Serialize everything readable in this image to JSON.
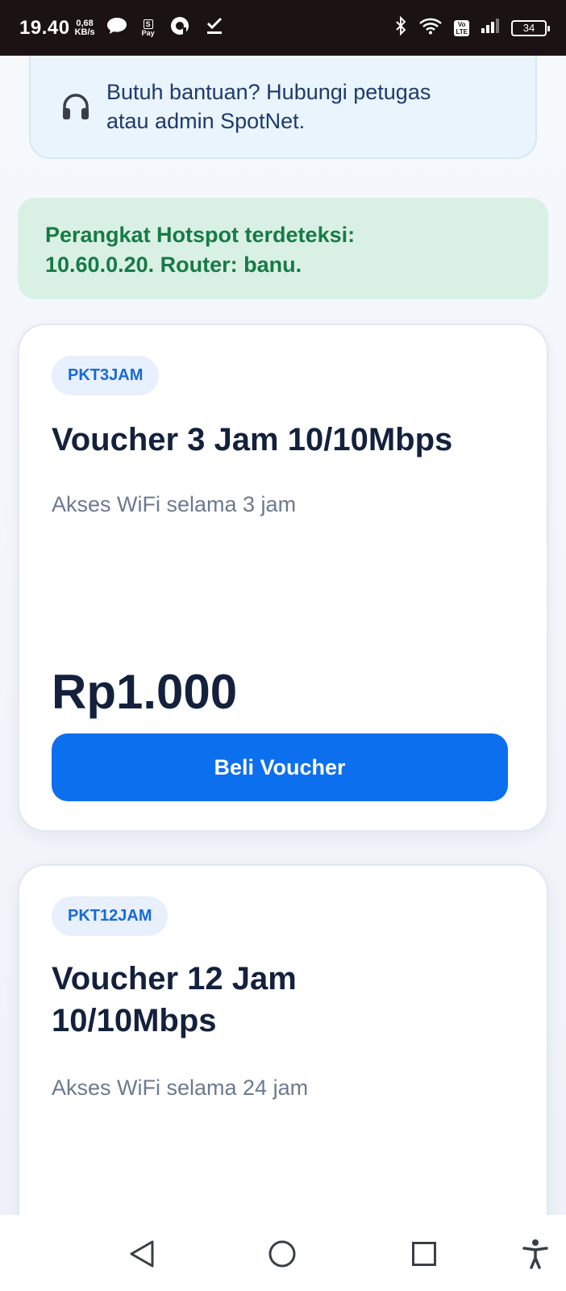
{
  "status_bar": {
    "time": "19.40",
    "speed_value": "0,68",
    "speed_unit": "KB/s",
    "volte_top": "Vo",
    "volte_bottom": "LTE",
    "battery": "34",
    "icons": [
      "chat-bubble-icon",
      "spay-icon",
      "circle-app-icon",
      "download-check-icon",
      "bluetooth-icon",
      "wifi-icon",
      "volte-icon",
      "signal-icon",
      "battery-icon"
    ],
    "spay_top": "S",
    "spay_bottom": "Pay"
  },
  "help_box": {
    "icon": "headset-icon",
    "text_line1": "Butuh bantuan? Hubungi petugas",
    "text_line2": "atau admin SpotNet."
  },
  "detect_box": {
    "line1": "Perangkat Hotspot terdeteksi:",
    "line2": "10.60.0.20. Router: banu."
  },
  "vouchers": [
    {
      "code": "PKT3JAM",
      "title": "Voucher 3 Jam 10/10Mbps",
      "description": "Akses WiFi selama 3 jam",
      "price": "Rp1.000",
      "button_label": "Beli Voucher"
    },
    {
      "code": "PKT12JAM",
      "title_line1": "Voucher 12 Jam",
      "title_line2": "10/10Mbps",
      "description": "Akses WiFi selama 24 jam"
    }
  ],
  "nav_bar": {
    "icons": [
      "back-icon",
      "home-icon",
      "recents-icon",
      "accessibility-icon"
    ]
  },
  "colors": {
    "primary_button": "#0c6fed",
    "badge_text": "#1769d8",
    "detect_text": "#177a46",
    "detect_bg": "#d9f1e4",
    "help_bg": "#eaf4fc"
  }
}
